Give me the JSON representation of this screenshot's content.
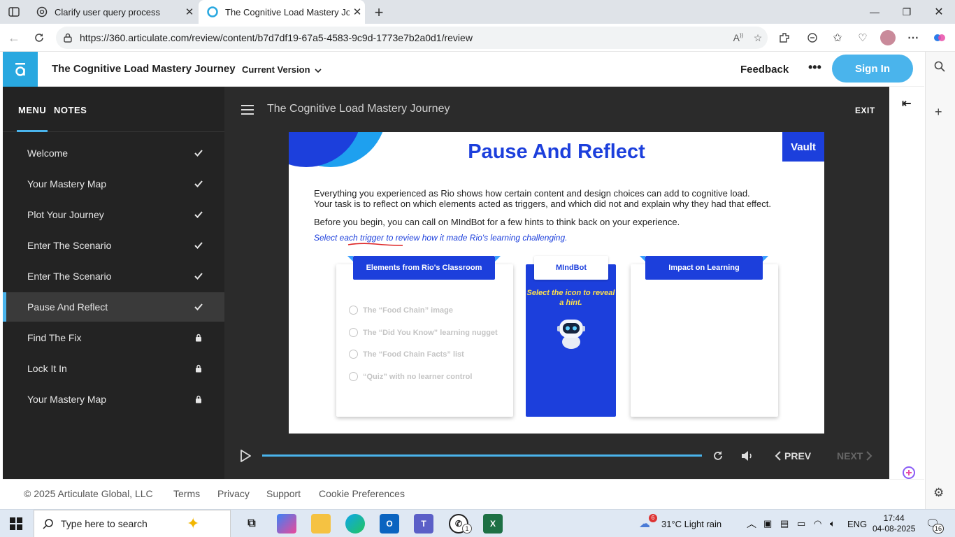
{
  "browser": {
    "tabs": [
      {
        "title": "Clarify user query process",
        "active": false
      },
      {
        "title": "The Cognitive Load Mastery Journ",
        "active": true
      }
    ],
    "url": "https://360.articulate.com/review/content/b7d7df19-67a5-4583-9c9d-1773e7b2a0d1/review"
  },
  "app": {
    "title": "The Cognitive Load Mastery Journey",
    "version_label": "Current Version",
    "feedback_label": "Feedback",
    "more_label": "•••",
    "signin_label": "Sign In"
  },
  "menu": {
    "tabs": [
      "MENU",
      "NOTES"
    ],
    "items": [
      {
        "label": "Welcome",
        "status": "done"
      },
      {
        "label": "Your Mastery Map",
        "status": "done"
      },
      {
        "label": "Plot Your Journey",
        "status": "done"
      },
      {
        "label": "Enter The Scenario",
        "status": "done"
      },
      {
        "label": "Enter The Scenario",
        "status": "done"
      },
      {
        "label": "Pause And Reflect",
        "status": "done"
      },
      {
        "label": "Find The Fix",
        "status": "locked"
      },
      {
        "label": "Lock It In",
        "status": "locked"
      },
      {
        "label": "Your Mastery Map",
        "status": "locked"
      }
    ]
  },
  "stage": {
    "title": "The Cognitive Load Mastery Journey",
    "exit_label": "EXIT"
  },
  "slide": {
    "title": "Pause And Reflect",
    "vault_label": "Vault",
    "para1": "Everything you experienced as Rio shows how certain content and design choices can add to cognitive load.",
    "para2": "Your task is to reflect on which elements acted as triggers, and which did not and explain why they had that effect.",
    "para3": "Before you begin, you can call on MIndBot for a few hints to think back on your experience.",
    "instruction": "Select each trigger to review how it made Rio's learning challenging.",
    "elements_header": "Elements from Rio's Classroom",
    "options": [
      "The “Food Chain” image",
      "The “Did You Know” learning nugget",
      "The “Food Chain Facts” list",
      "“Quiz” with no learner control"
    ],
    "bot_header": "MIndBot",
    "bot_hint": "Select the icon to reveal a hint.",
    "impact_header": "Impact on Learning"
  },
  "controls": {
    "prev_label": "PREV",
    "next_label": "NEXT"
  },
  "footer": {
    "copyright": "© 2025 Articulate Global, LLC",
    "links": [
      "Terms",
      "Privacy",
      "Support",
      "Cookie Preferences"
    ]
  },
  "taskbar": {
    "search_placeholder": "Type here to search",
    "weather": "31°C  Light rain",
    "weather_badge": "6",
    "whatsapp_badge": "1",
    "lang": "ENG",
    "time": "17:44",
    "date": "04-08-2025",
    "notif_count": "16"
  },
  "colors": {
    "accent": "#4ab4ec",
    "slide_blue": "#1c3fdc",
    "hint_yellow": "#ffe14d"
  }
}
